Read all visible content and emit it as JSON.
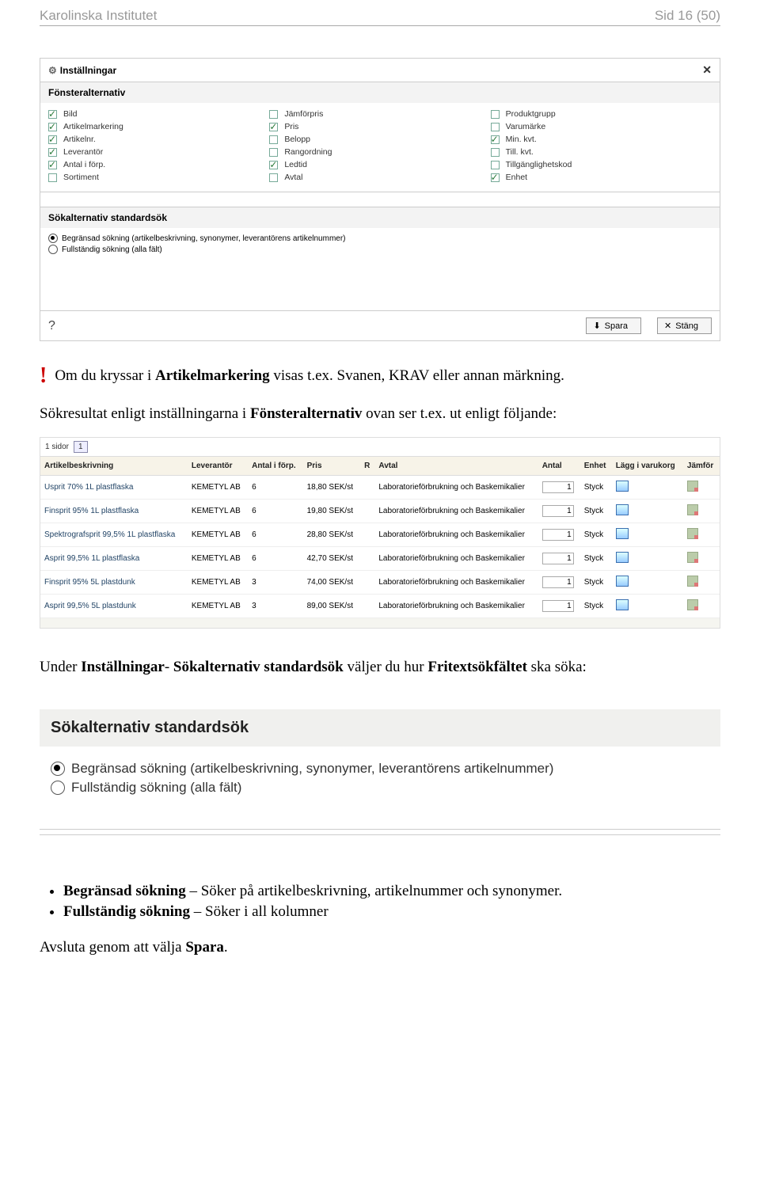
{
  "header": {
    "org": "Karolinska Institutet",
    "page": "Sid 16 (50)"
  },
  "settings_panel": {
    "title": "Inställningar",
    "section_window": {
      "title": "Fönsteralternativ",
      "col1": [
        {
          "label": "Bild",
          "checked": true
        },
        {
          "label": "Artikelmarkering",
          "checked": true
        },
        {
          "label": "Artikelnr.",
          "checked": true
        },
        {
          "label": "Leverantör",
          "checked": true
        },
        {
          "label": "Antal i förp.",
          "checked": true
        },
        {
          "label": "Sortiment",
          "checked": false
        }
      ],
      "col2": [
        {
          "label": "Jämförpris",
          "checked": false
        },
        {
          "label": "Pris",
          "checked": true
        },
        {
          "label": "Belopp",
          "checked": false
        },
        {
          "label": "Rangordning",
          "checked": false
        },
        {
          "label": "Ledtid",
          "checked": true
        },
        {
          "label": "Avtal",
          "checked": false
        }
      ],
      "col3": [
        {
          "label": "Produktgrupp",
          "checked": false
        },
        {
          "label": "Varumärke",
          "checked": false
        },
        {
          "label": "Min. kvt.",
          "checked": true
        },
        {
          "label": "Till. kvt.",
          "checked": false
        },
        {
          "label": "Tillgänglighetskod",
          "checked": false
        },
        {
          "label": "Enhet",
          "checked": true
        }
      ]
    },
    "section_search": {
      "title": "Sökalternativ standardsök",
      "opt1": "Begränsad sökning (artikelbeskrivning, synonymer, leverantörens artikelnummer)",
      "opt2": "Fullständig sökning (alla fält)"
    },
    "save": "Spara",
    "close": "Stäng",
    "help": "?"
  },
  "note1_a": "Om du kryssar i ",
  "note1_b": "Artikelmarkering",
  "note1_c": " visas t.ex. Svanen, KRAV eller annan märkning.",
  "note2_a": "Sökresultat enligt inställningarna i ",
  "note2_b": "Fönsteralternativ",
  "note2_c": " ovan ser t.ex. ut enligt följande:",
  "pager": {
    "label": "1 sidor",
    "current": "1"
  },
  "result_table": {
    "headers": [
      "Artikelbeskrivning",
      "Leverantör",
      "Antal i förp.",
      "Pris",
      "R",
      "Avtal",
      "Antal",
      "Enhet",
      "Lägg i varukorg",
      "Jämför"
    ],
    "rows": [
      {
        "desc": "Usprit 70% 1L plastflaska",
        "lev": "KEMETYL AB",
        "pack": "6",
        "price": "18,80 SEK/st",
        "avtal": "Laboratorieförbrukning och Baskemikalier",
        "antal": "1",
        "enhet": "Styck"
      },
      {
        "desc": "Finsprit 95% 1L plastflaska",
        "lev": "KEMETYL AB",
        "pack": "6",
        "price": "19,80 SEK/st",
        "avtal": "Laboratorieförbrukning och Baskemikalier",
        "antal": "1",
        "enhet": "Styck"
      },
      {
        "desc": "Spektrografsprit 99,5% 1L plastflaska",
        "lev": "KEMETYL AB",
        "pack": "6",
        "price": "28,80 SEK/st",
        "avtal": "Laboratorieförbrukning och Baskemikalier",
        "antal": "1",
        "enhet": "Styck"
      },
      {
        "desc": "Asprit 99,5% 1L plastflaska",
        "lev": "KEMETYL AB",
        "pack": "6",
        "price": "42,70 SEK/st",
        "avtal": "Laboratorieförbrukning och Baskemikalier",
        "antal": "1",
        "enhet": "Styck"
      },
      {
        "desc": "Finsprit 95% 5L plastdunk",
        "lev": "KEMETYL AB",
        "pack": "3",
        "price": "74,00 SEK/st",
        "avtal": "Laboratorieförbrukning och Baskemikalier",
        "antal": "1",
        "enhet": "Styck"
      },
      {
        "desc": "Asprit 99,5% 5L plastdunk",
        "lev": "KEMETYL AB",
        "pack": "3",
        "price": "89,00 SEK/st",
        "avtal": "Laboratorieförbrukning och Baskemikalier",
        "antal": "1",
        "enhet": "Styck"
      }
    ]
  },
  "note3_a": "Under ",
  "note3_b": "Inställningar",
  "note3_c": "- ",
  "note3_d": "Sökalternativ standardsök",
  "note3_e": " väljer du hur ",
  "note3_f": "Fritextsökfältet",
  "note3_g": " ska söka:",
  "big_section": {
    "title": "Sökalternativ standardsök",
    "opt1": "Begränsad sökning (artikelbeskrivning, synonymer, leverantörens artikelnummer)",
    "opt2": "Fullständig sökning (alla fält)"
  },
  "bullets": {
    "b1a": "Begränsad sökning",
    "b1b": " – Söker på artikelbeskrivning, artikelnummer och synonymer.",
    "b2a": "Fullständig sökning",
    "b2b": " – Söker i all kolumner"
  },
  "closing_a": "Avsluta genom att välja ",
  "closing_b": "Spara",
  "closing_c": "."
}
